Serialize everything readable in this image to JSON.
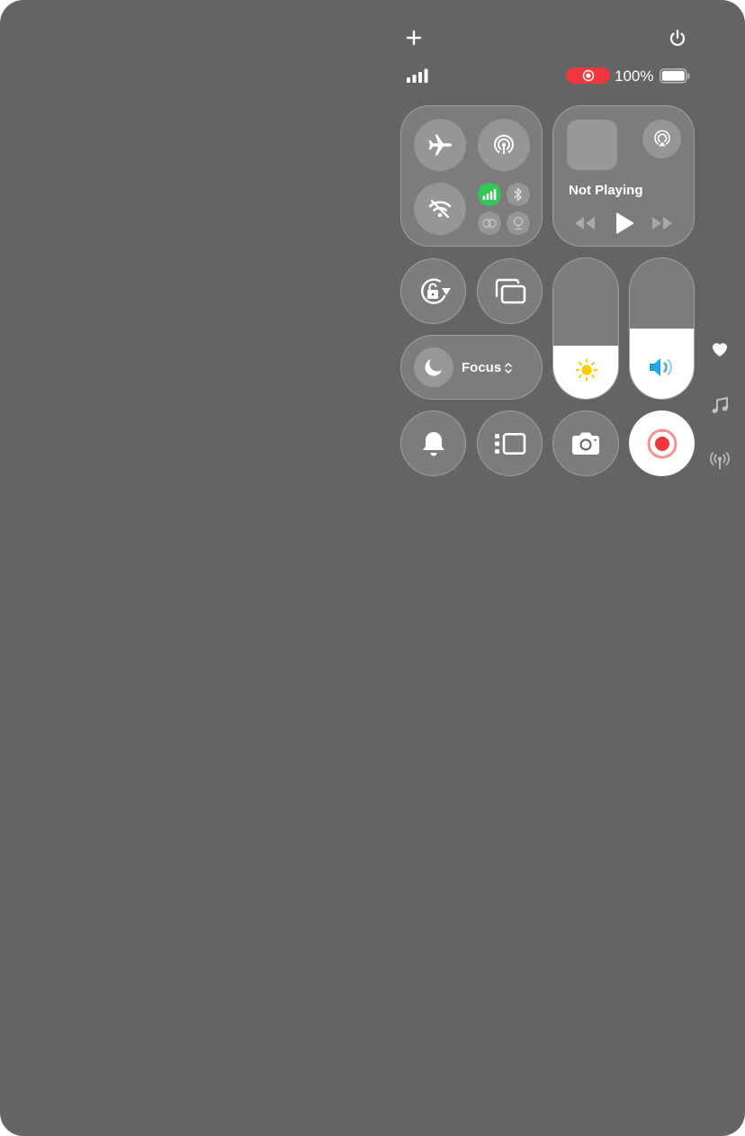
{
  "status": {
    "battery_percent_label": "100%",
    "battery_level": 1.0,
    "cellular_bars": 4,
    "recording_active": true
  },
  "top_actions": {
    "add_icon": "plus-icon",
    "power_icon": "power-icon"
  },
  "connectivity": {
    "airplane_mode": false,
    "airdrop": true,
    "wifi": false,
    "cellular_data": true,
    "bluetooth": false,
    "focus_link": false,
    "satellite": false
  },
  "now_playing": {
    "title": "Not Playing",
    "playing": false
  },
  "controls": {
    "orientation_lock": false,
    "screen_mirroring": false,
    "focus": {
      "label": "Focus",
      "icon": "moon-icon"
    },
    "silent_mode_icon": "bell-icon",
    "stage_manager_icon": "stage-manager-icon",
    "camera_icon": "camera-icon",
    "screen_recording": true
  },
  "sliders": {
    "brightness": 0.38,
    "volume": 0.5
  },
  "side_pages": [
    "heart-icon",
    "music-note-icon",
    "antenna-icon"
  ],
  "colors": {
    "background": "#646466",
    "active_green": "#34c759",
    "record_red": "#f0373d",
    "brightness_yellow": "#ffcc00",
    "volume_blue": "#1ea7e0"
  }
}
